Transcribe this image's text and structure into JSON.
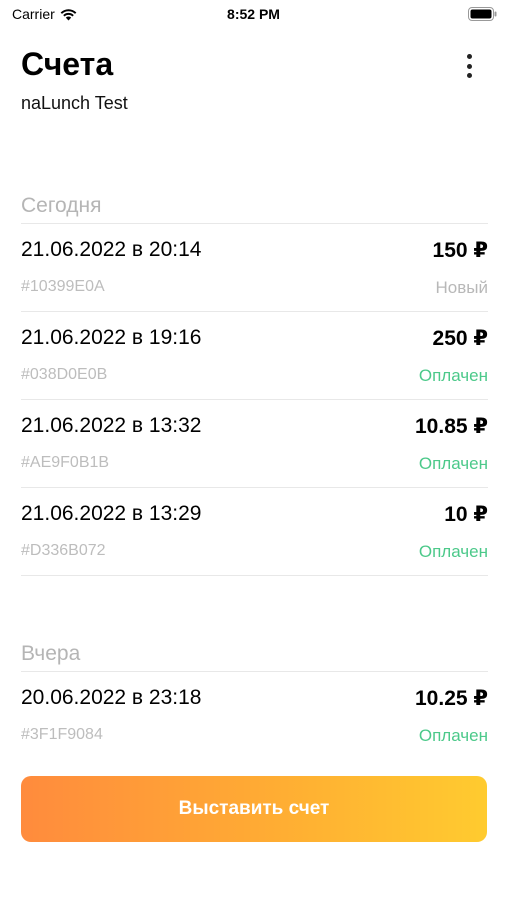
{
  "status_bar": {
    "carrier": "Carrier",
    "time": "8:52 PM"
  },
  "header": {
    "title": "Счета",
    "subtitle": "naLunch Test"
  },
  "sections": [
    {
      "title": "Сегодня",
      "rows": [
        {
          "date": "21.06.2022 в 20:14",
          "amount": "150 ₽",
          "id": "#10399E0A",
          "status": "Новый"
        },
        {
          "date": "21.06.2022 в 19:16",
          "amount": "250 ₽",
          "id": "#038D0E0B",
          "status": "Оплачен"
        },
        {
          "date": "21.06.2022 в 13:32",
          "amount": "10.85 ₽",
          "id": "#AE9F0B1B",
          "status": "Оплачен"
        },
        {
          "date": "21.06.2022 в 13:29",
          "amount": "10 ₽",
          "id": "#D336B072",
          "status": "Оплачен"
        }
      ]
    },
    {
      "title": "Вчера",
      "rows": [
        {
          "date": "20.06.2022 в 23:18",
          "amount": "10.25 ₽",
          "id": "#3F1F9084",
          "status": "Оплачен"
        }
      ]
    }
  ],
  "cta_label": "Выставить счет",
  "colors": {
    "status_paid": "#4cc98a",
    "status_new": "#b8b8b8",
    "cta_gradient_start": "#ff8b3d",
    "cta_gradient_end": "#ffcb2f"
  },
  "icons": {
    "more": "more-vertical-icon",
    "wifi": "wifi-icon",
    "battery": "battery-icon"
  }
}
